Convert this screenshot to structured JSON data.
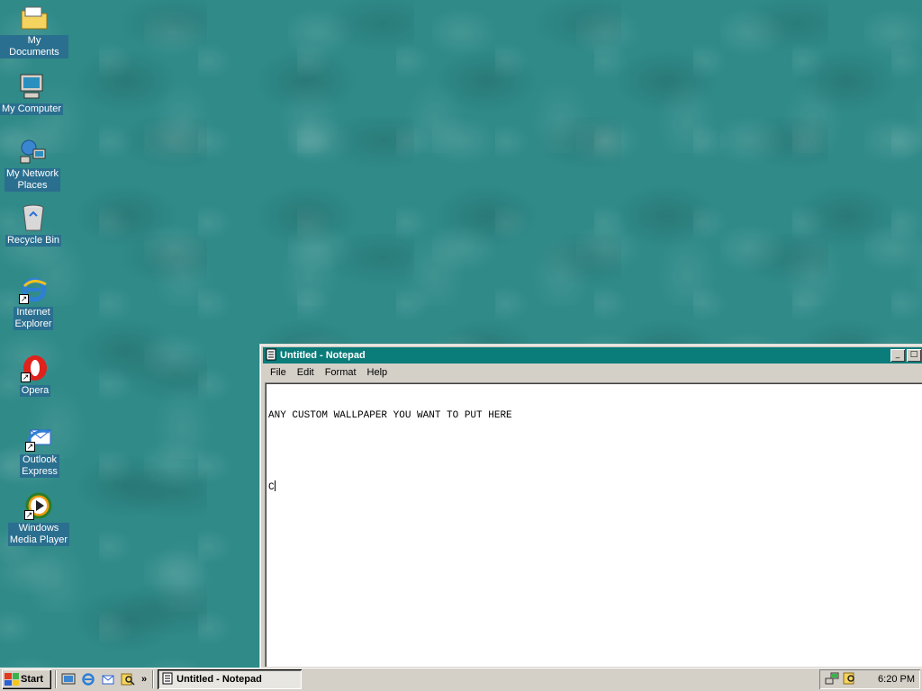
{
  "desktop": {
    "icons": [
      {
        "label_lines": [
          "My Documents"
        ],
        "icon": "folder-icon"
      },
      {
        "label_lines": [
          "My Computer"
        ],
        "icon": "computer-icon"
      },
      {
        "label_lines": [
          "My Network",
          "Places"
        ],
        "icon": "network-icon"
      },
      {
        "label_lines": [
          "Recycle Bin"
        ],
        "icon": "recycle-bin-icon"
      },
      {
        "label_lines": [
          "Internet",
          "Explorer"
        ],
        "icon": "internet-explorer-icon"
      },
      {
        "label_lines": [
          "Opera"
        ],
        "icon": "opera-icon"
      },
      {
        "label_lines": [
          "Outlook",
          "Express"
        ],
        "icon": "outlook-express-icon"
      },
      {
        "label_lines": [
          "Windows",
          "Media Player"
        ],
        "icon": "media-player-icon"
      }
    ],
    "colors": {
      "wallpaper": "#2f8a88",
      "icon_label_bg": "#2a6f8f"
    }
  },
  "notepad": {
    "title": "Untitled - Notepad",
    "menu": [
      "File",
      "Edit",
      "Format",
      "Help"
    ],
    "content_lines": [
      "ANY CUSTOM WALLPAPER YOU WANT TO PUT HERE",
      "",
      "C"
    ],
    "minimize_glyph": "_",
    "maximize_glyph": "□"
  },
  "taskbar": {
    "start_label": "Start",
    "quick_launch": [
      "show-desktop-icon",
      "internet-explorer-icon",
      "outlook-express-icon",
      "search-icon"
    ],
    "quick_launch_more": "»",
    "task_label": "Untitled - Notepad",
    "clock": "6:20 PM"
  }
}
